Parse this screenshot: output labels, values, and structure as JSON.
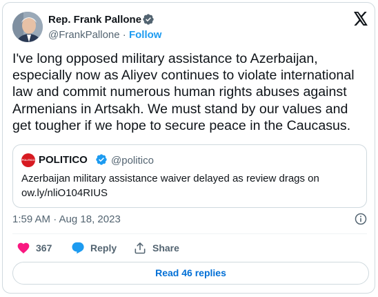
{
  "author": {
    "name": "Rep. Frank Pallone",
    "handle": "@FrankPallone",
    "separator": " · ",
    "follow_label": "Follow"
  },
  "tweet": {
    "text": "I've long opposed military assistance to Azerbaijan, especially now as Aliyev continues to violate international law and commit numerous human rights abuses against Armenians in Artsakh. We must stand by our values and get tougher if we hope to secure peace in the Caucasus."
  },
  "quote": {
    "name": "POLITICO",
    "handle": "@politico",
    "avatar_text": "POLITICO",
    "text_line1": "Azerbaijan military assistance waiver delayed as review drags on",
    "text_line2": "ow.ly/nliO104RIUS"
  },
  "meta": {
    "timestamp": "1:59 AM · Aug 18, 2023"
  },
  "actions": {
    "like_count": "367",
    "reply_label": "Reply",
    "share_label": "Share"
  },
  "replies_button": "Read 46 replies",
  "colors": {
    "link": "#1d9bf0",
    "like": "#f91880",
    "text": "#0f1419",
    "muted": "#536471",
    "border": "#cfd9de",
    "politico_red": "#d71a21"
  }
}
